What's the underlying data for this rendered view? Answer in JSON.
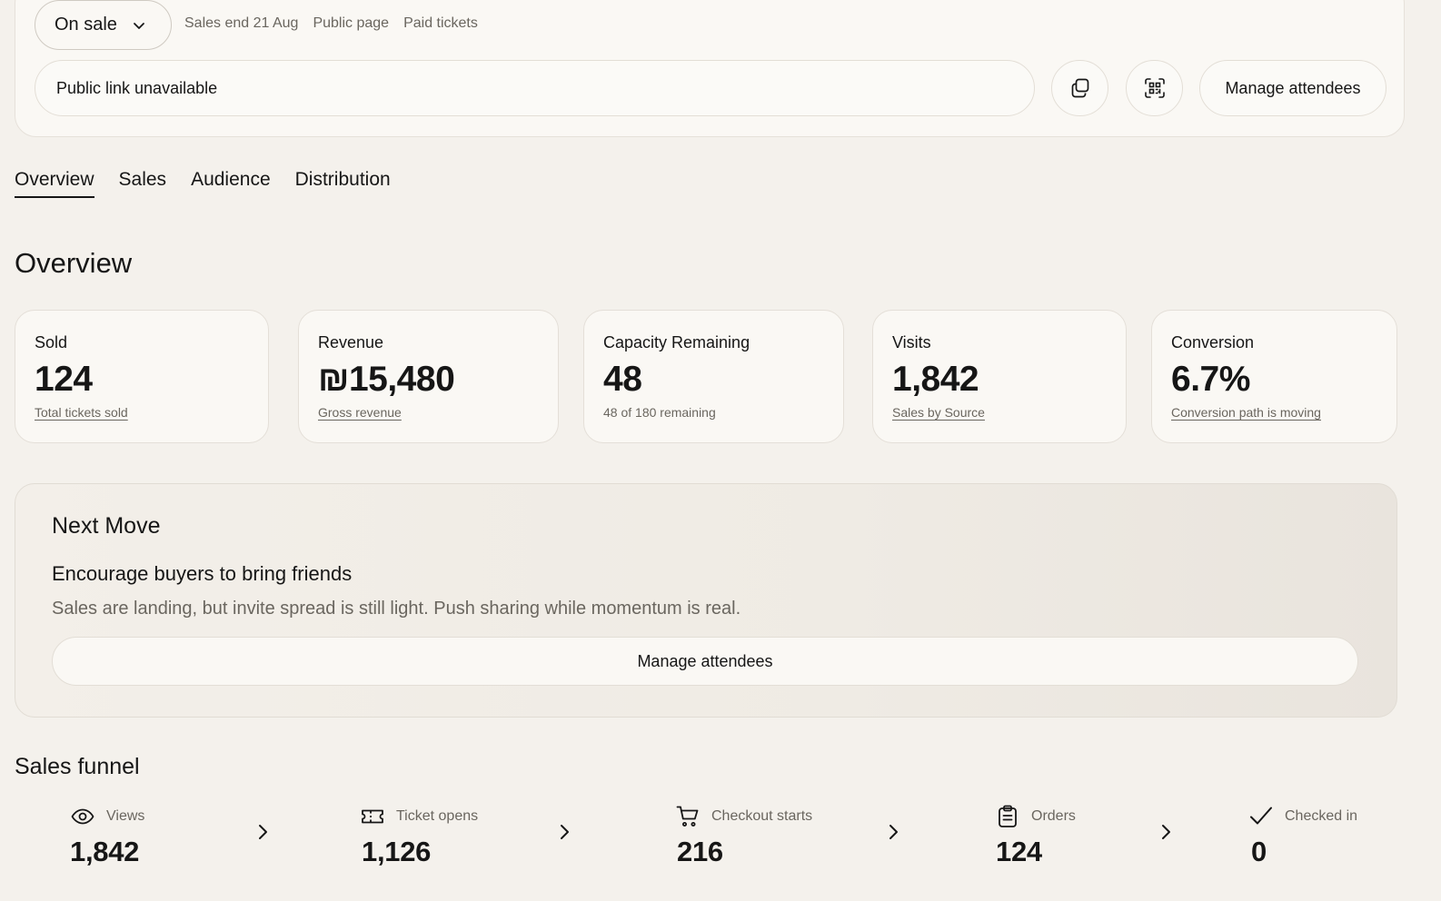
{
  "header": {
    "status": "On sale",
    "meta": [
      "Sales end 21 Aug",
      "Public page",
      "Paid tickets"
    ],
    "link_text": "Public link unavailable",
    "copy_icon": "copy-icon",
    "qr_icon": "qr-code-icon",
    "manage_label": "Manage attendees"
  },
  "tabs": [
    {
      "label": "Overview",
      "active": true
    },
    {
      "label": "Sales",
      "active": false
    },
    {
      "label": "Audience",
      "active": false
    },
    {
      "label": "Distribution",
      "active": false
    }
  ],
  "overview": {
    "title": "Overview",
    "stats": [
      {
        "label": "Sold",
        "value": "124",
        "sub": "Total tickets sold",
        "sub_link": true
      },
      {
        "label": "Revenue",
        "value": "₪15,480",
        "sub": "Gross revenue",
        "sub_link": true
      },
      {
        "label": "Capacity Remaining",
        "value": "48",
        "sub": "48 of 180 remaining",
        "sub_link": false
      },
      {
        "label": "Visits",
        "value": "1,842",
        "sub": "Sales by Source",
        "sub_link": true
      },
      {
        "label": "Conversion",
        "value": "6.7%",
        "sub": "Conversion path is moving",
        "sub_link": true
      }
    ]
  },
  "next_move": {
    "title": "Next Move",
    "headline": "Encourage buyers to bring friends",
    "description": "Sales are landing, but invite spread is still light. Push sharing while momentum is real.",
    "button": "Manage attendees"
  },
  "funnel": {
    "title": "Sales funnel",
    "steps": [
      {
        "icon": "eye-icon",
        "label": "Views",
        "value": "1,842"
      },
      {
        "icon": "ticket-icon",
        "label": "Ticket opens",
        "value": "1,126"
      },
      {
        "icon": "cart-icon",
        "label": "Checkout starts",
        "value": "216"
      },
      {
        "icon": "clipboard-icon",
        "label": "Orders",
        "value": "124"
      },
      {
        "icon": "check-icon",
        "label": "Checked in",
        "value": "0"
      }
    ]
  }
}
